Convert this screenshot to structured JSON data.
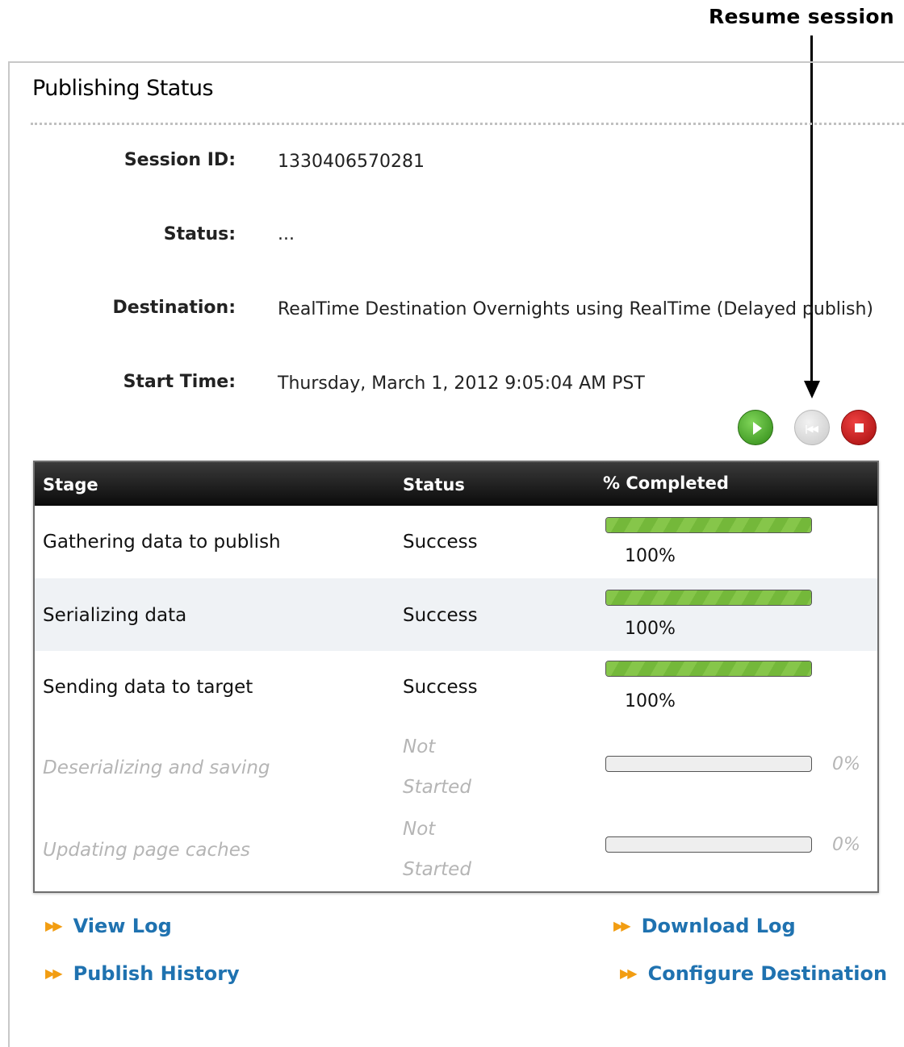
{
  "annotation": {
    "label": "Resume session"
  },
  "panel": {
    "title": "Publishing Status"
  },
  "info": {
    "session_id_label": "Session ID:",
    "session_id": "1330406570281",
    "status_label": "Status:",
    "status": "...",
    "destination_label": "Destination:",
    "destination": "RealTime Destination Overnights using RealTime (Delayed publish)",
    "start_time_label": "Start Time:",
    "start_time": "Thursday, March 1, 2012 9:05:04 AM PST"
  },
  "controls": {
    "play_icon": "play-icon",
    "resume_icon": "resume-session-icon",
    "stop_icon": "stop-icon",
    "colors": {
      "play": "#3aa11e",
      "resume": "#d6d6d6",
      "stop": "#c41616"
    }
  },
  "table": {
    "headers": {
      "stage": "Stage",
      "status": "Status",
      "completed": "% Completed"
    },
    "rows": [
      {
        "stage": "Gathering data to publish",
        "status": "Success",
        "percent_label": "100%",
        "progress": 1.0
      },
      {
        "stage": "Serializing data",
        "status": "Success",
        "percent_label": "100%",
        "progress": 1.0
      },
      {
        "stage": "Sending data to target",
        "status": "Success",
        "percent_label": "100%",
        "progress": 1.0
      },
      {
        "stage": "Deserializing and saving",
        "status_line1": "Not",
        "status_line2": "Started",
        "percent_label": "0%",
        "progress": 0.0
      },
      {
        "stage": "Updating page caches",
        "status_line1": "Not",
        "status_line2": "Started",
        "percent_label": "0%",
        "progress": 0.0
      }
    ]
  },
  "links": {
    "view_log": "View Log",
    "download_log": "Download Log",
    "publish_history": "Publish History",
    "configure_destination": "Configure Destination",
    "link_color": "#1f72b0",
    "bullet_color": "#f29d12"
  }
}
